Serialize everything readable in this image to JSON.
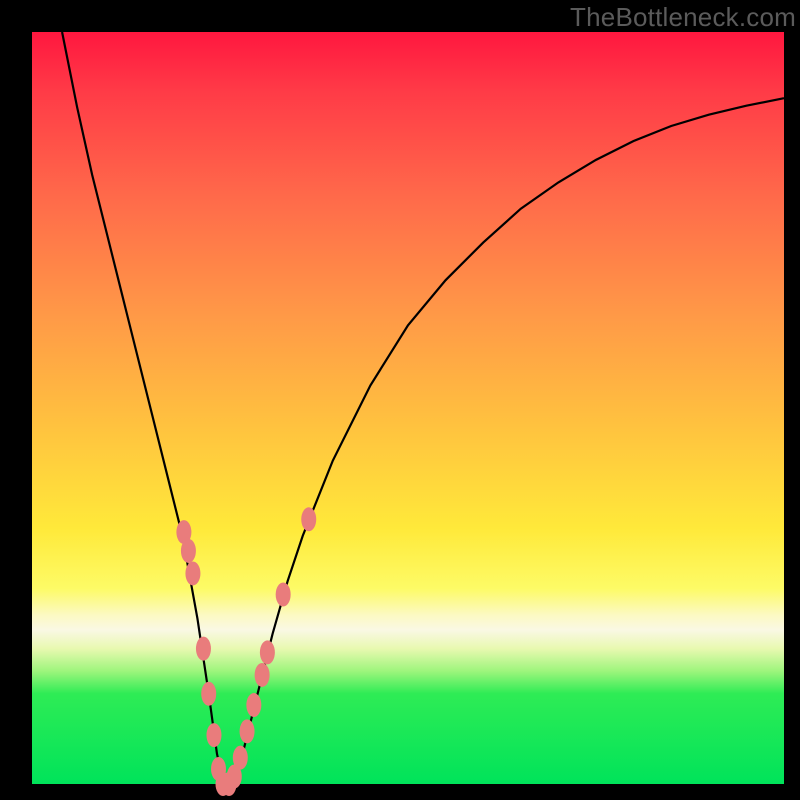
{
  "watermark": "TheBottleneck.com",
  "colors": {
    "curve_stroke": "#000000",
    "marker_fill": "#e97c7c",
    "marker_stroke": "#a83d3d",
    "frame": "#000000"
  },
  "chart_data": {
    "type": "line",
    "title": "",
    "xlabel": "",
    "ylabel": "",
    "xlim": [
      0,
      100
    ],
    "ylim": [
      0,
      100
    ],
    "grid": false,
    "legend": false,
    "series": [
      {
        "name": "bottleneck-curve",
        "x": [
          4,
          6,
          8,
          10,
          12,
          14,
          16,
          18,
          20,
          22,
          23.5,
          24.6,
          25.5,
          26.5,
          28,
          30,
          32,
          34,
          36,
          40,
          45,
          50,
          55,
          60,
          65,
          70,
          75,
          80,
          85,
          90,
          95,
          100
        ],
        "y": [
          100,
          90,
          81,
          73,
          65,
          57,
          49,
          41,
          33,
          22,
          12,
          4,
          0,
          0,
          4,
          12,
          20,
          27,
          33,
          43,
          53,
          61,
          67,
          72,
          76.5,
          80,
          83,
          85.5,
          87.5,
          89,
          90.2,
          91.2
        ]
      }
    ],
    "markers": {
      "name": "highlighted-points",
      "points": [
        {
          "x": 20.2,
          "y": 33.5
        },
        {
          "x": 20.8,
          "y": 31.0
        },
        {
          "x": 21.4,
          "y": 28.0
        },
        {
          "x": 22.8,
          "y": 18.0
        },
        {
          "x": 23.5,
          "y": 12.0
        },
        {
          "x": 24.2,
          "y": 6.5
        },
        {
          "x": 24.8,
          "y": 2.0
        },
        {
          "x": 25.4,
          "y": 0.0
        },
        {
          "x": 26.2,
          "y": 0.0
        },
        {
          "x": 26.9,
          "y": 1.0
        },
        {
          "x": 27.7,
          "y": 3.5
        },
        {
          "x": 28.6,
          "y": 7.0
        },
        {
          "x": 29.5,
          "y": 10.5
        },
        {
          "x": 30.6,
          "y": 14.5
        },
        {
          "x": 31.3,
          "y": 17.5
        },
        {
          "x": 33.4,
          "y": 25.2
        },
        {
          "x": 36.8,
          "y": 35.2
        }
      ]
    }
  }
}
